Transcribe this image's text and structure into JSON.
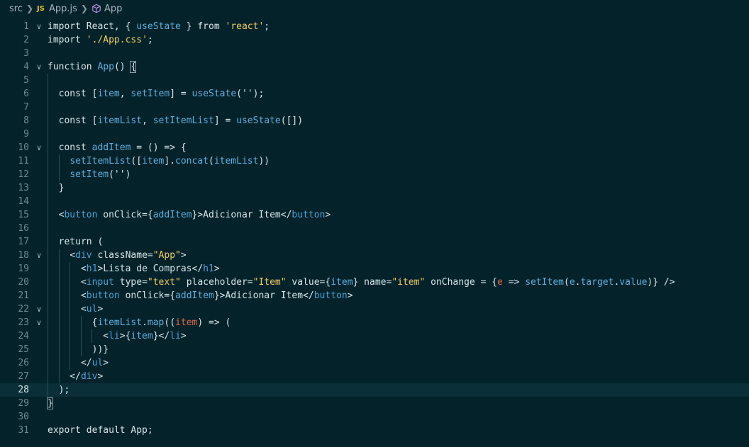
{
  "breadcrumb": {
    "folder": "src",
    "file": "App.js",
    "file_badge": "JS",
    "symbol": "App",
    "symbol_icon": "cube-icon"
  },
  "editor": {
    "current_line": 28,
    "folded_lines": [
      1,
      4,
      10,
      18,
      22,
      23
    ],
    "lines": [
      [
        [
          "import React, { ",
          "p"
        ],
        [
          "useState",
          "b"
        ],
        [
          " } from ",
          "p"
        ],
        [
          "'react'",
          "s"
        ],
        [
          ";",
          "p"
        ]
      ],
      [
        [
          "import ",
          "p"
        ],
        [
          "'./App.css'",
          "s"
        ],
        [
          ";",
          "p"
        ]
      ],
      [],
      [
        [
          "function ",
          "p"
        ],
        [
          "App",
          "b"
        ],
        [
          "() ",
          "p"
        ],
        [
          "{",
          "p"
        ]
      ],
      [],
      [
        [
          "  const [",
          "p"
        ],
        [
          "item",
          "b"
        ],
        [
          ", ",
          "p"
        ],
        [
          "setItem",
          "b"
        ],
        [
          "] = ",
          "p"
        ],
        [
          "useState",
          "b"
        ],
        [
          "('');",
          "p"
        ]
      ],
      [],
      [
        [
          "  const [",
          "p"
        ],
        [
          "itemList",
          "b"
        ],
        [
          ", ",
          "p"
        ],
        [
          "setItemList",
          "b"
        ],
        [
          "] = ",
          "p"
        ],
        [
          "useState",
          "b"
        ],
        [
          "([])",
          "p"
        ]
      ],
      [],
      [
        [
          "  const ",
          "p"
        ],
        [
          "addItem",
          "b"
        ],
        [
          " = () => {",
          "p"
        ]
      ],
      [
        [
          "    ",
          "p"
        ],
        [
          "setItemList",
          "b"
        ],
        [
          "([",
          "p"
        ],
        [
          "item",
          "b"
        ],
        [
          "].",
          "p"
        ],
        [
          "concat",
          "b"
        ],
        [
          "(",
          "p"
        ],
        [
          "itemList",
          "b"
        ],
        [
          "))",
          "p"
        ]
      ],
      [
        [
          "    ",
          "p"
        ],
        [
          "setItem",
          "b"
        ],
        [
          "('')",
          "p"
        ]
      ],
      [
        [
          "  }",
          "p"
        ]
      ],
      [],
      [
        [
          "  <",
          "p"
        ],
        [
          "button",
          "tag"
        ],
        [
          " onClick={",
          "p"
        ],
        [
          "addItem",
          "b"
        ],
        [
          "}>Adicionar Item</",
          "p"
        ],
        [
          "button",
          "tag"
        ],
        [
          ">",
          "p"
        ]
      ],
      [],
      [
        [
          "  return (",
          "p"
        ]
      ],
      [
        [
          "    <",
          "p"
        ],
        [
          "div",
          "tag"
        ],
        [
          " className=",
          "p"
        ],
        [
          "\"App\"",
          "s"
        ],
        [
          ">",
          "p"
        ]
      ],
      [
        [
          "      <",
          "p"
        ],
        [
          "h1",
          "tag"
        ],
        [
          ">Lista de Compras</",
          "p"
        ],
        [
          "h1",
          "tag"
        ],
        [
          ">",
          "p"
        ]
      ],
      [
        [
          "      <",
          "p"
        ],
        [
          "input",
          "tag"
        ],
        [
          " type=",
          "p"
        ],
        [
          "\"text\"",
          "s"
        ],
        [
          " placeholder=",
          "p"
        ],
        [
          "\"Item\"",
          "s"
        ],
        [
          " value={",
          "p"
        ],
        [
          "item",
          "b"
        ],
        [
          "} name=",
          "p"
        ],
        [
          "\"item\"",
          "s"
        ],
        [
          " onChange = {",
          "p"
        ],
        [
          "e",
          "r"
        ],
        [
          " => ",
          "p"
        ],
        [
          "setItem",
          "b"
        ],
        [
          "(",
          "p"
        ],
        [
          "e",
          "b"
        ],
        [
          ".",
          "p"
        ],
        [
          "target",
          "b"
        ],
        [
          ".",
          "p"
        ],
        [
          "value",
          "b"
        ],
        [
          ")} />",
          "p"
        ]
      ],
      [
        [
          "      <",
          "p"
        ],
        [
          "button",
          "tag"
        ],
        [
          " onClick={",
          "p"
        ],
        [
          "addItem",
          "b"
        ],
        [
          "}>Adicionar Item</",
          "p"
        ],
        [
          "button",
          "tag"
        ],
        [
          ">",
          "p"
        ]
      ],
      [
        [
          "      <",
          "p"
        ],
        [
          "ul",
          "tag"
        ],
        [
          ">",
          "p"
        ]
      ],
      [
        [
          "        {",
          "p"
        ],
        [
          "itemList",
          "b"
        ],
        [
          ".",
          "p"
        ],
        [
          "map",
          "b"
        ],
        [
          "((",
          "p"
        ],
        [
          "item",
          "r"
        ],
        [
          ") => (",
          "p"
        ]
      ],
      [
        [
          "          <",
          "p"
        ],
        [
          "li",
          "tag"
        ],
        [
          ">{",
          "p"
        ],
        [
          "item",
          "b"
        ],
        [
          "}</",
          "p"
        ],
        [
          "li",
          "tag"
        ],
        [
          ">",
          "p"
        ]
      ],
      [
        [
          "        ))}",
          "p"
        ]
      ],
      [
        [
          "      </",
          "p"
        ],
        [
          "ul",
          "tag"
        ],
        [
          ">",
          "p"
        ]
      ],
      [
        [
          "    </",
          "p"
        ],
        [
          "div",
          "tag"
        ],
        [
          ">",
          "p"
        ]
      ],
      [
        [
          "  );",
          "p"
        ]
      ],
      [
        [
          "}",
          "p"
        ]
      ],
      [],
      [
        [
          "export default App;",
          "p"
        ]
      ]
    ]
  }
}
